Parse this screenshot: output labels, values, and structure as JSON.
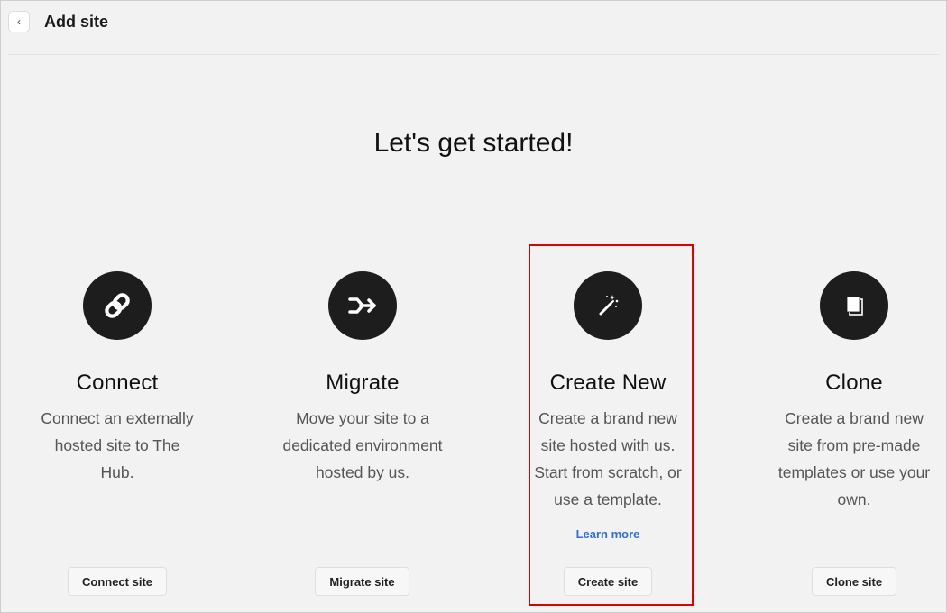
{
  "header": {
    "back_icon": "chevron-left-icon",
    "back_glyph": "‹",
    "title": "Add site"
  },
  "headline": "Let's get started!",
  "options": [
    {
      "icon": "link-icon",
      "title": "Connect",
      "description": "Connect an externally hosted site to The Hub.",
      "button": "Connect site"
    },
    {
      "icon": "migrate-arrow-icon",
      "title": "Migrate",
      "description": "Move your site to a dedicated environment hosted by us.",
      "button": "Migrate site"
    },
    {
      "icon": "magic-wand-icon",
      "title": "Create New",
      "description": "Create a brand new site hosted with us. Start from scratch, or use a template.",
      "link": "Learn more",
      "button": "Create site",
      "highlighted": true
    },
    {
      "icon": "copy-pages-icon",
      "title": "Clone",
      "description": "Create a brand new site from pre-made templates or use your own.",
      "button": "Clone site"
    }
  ],
  "colors": {
    "background": "#f2f2f2",
    "icon_circle": "#1d1d1d",
    "link": "#2f6fd6",
    "highlight_border": "#e00000"
  }
}
